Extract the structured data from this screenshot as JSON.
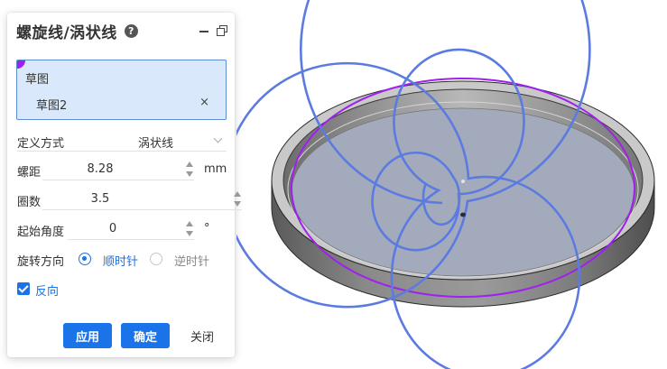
{
  "panel": {
    "title": "螺旋线/涡状线",
    "help_icon": "?",
    "sketch": {
      "label": "草图",
      "selected_item": "草图2",
      "remove_glyph": "×"
    },
    "definition": {
      "label": "定义方式",
      "value": "涡状线"
    },
    "pitch": {
      "label": "螺距",
      "value": "8.28",
      "unit": "mm"
    },
    "turns": {
      "label": "圈数",
      "value": "3.5"
    },
    "start_angle": {
      "label": "起始角度",
      "value": "0",
      "unit": "°"
    },
    "direction": {
      "label": "旋转方向",
      "options": [
        "顺时针",
        "逆时针"
      ],
      "selected": "顺时针"
    },
    "reverse": {
      "label": "反向",
      "checked": true
    },
    "buttons": {
      "apply": "应用",
      "ok": "确定",
      "close": "关闭"
    }
  },
  "colors": {
    "accent": "#1a73e8",
    "selection": "#a020f0",
    "sketch_bg": "#d9e9fb",
    "spiral": "#5b7be0"
  },
  "icons": [
    "help-icon",
    "minimize-icon",
    "restore-icon",
    "remove-icon",
    "chevron-down-icon"
  ]
}
